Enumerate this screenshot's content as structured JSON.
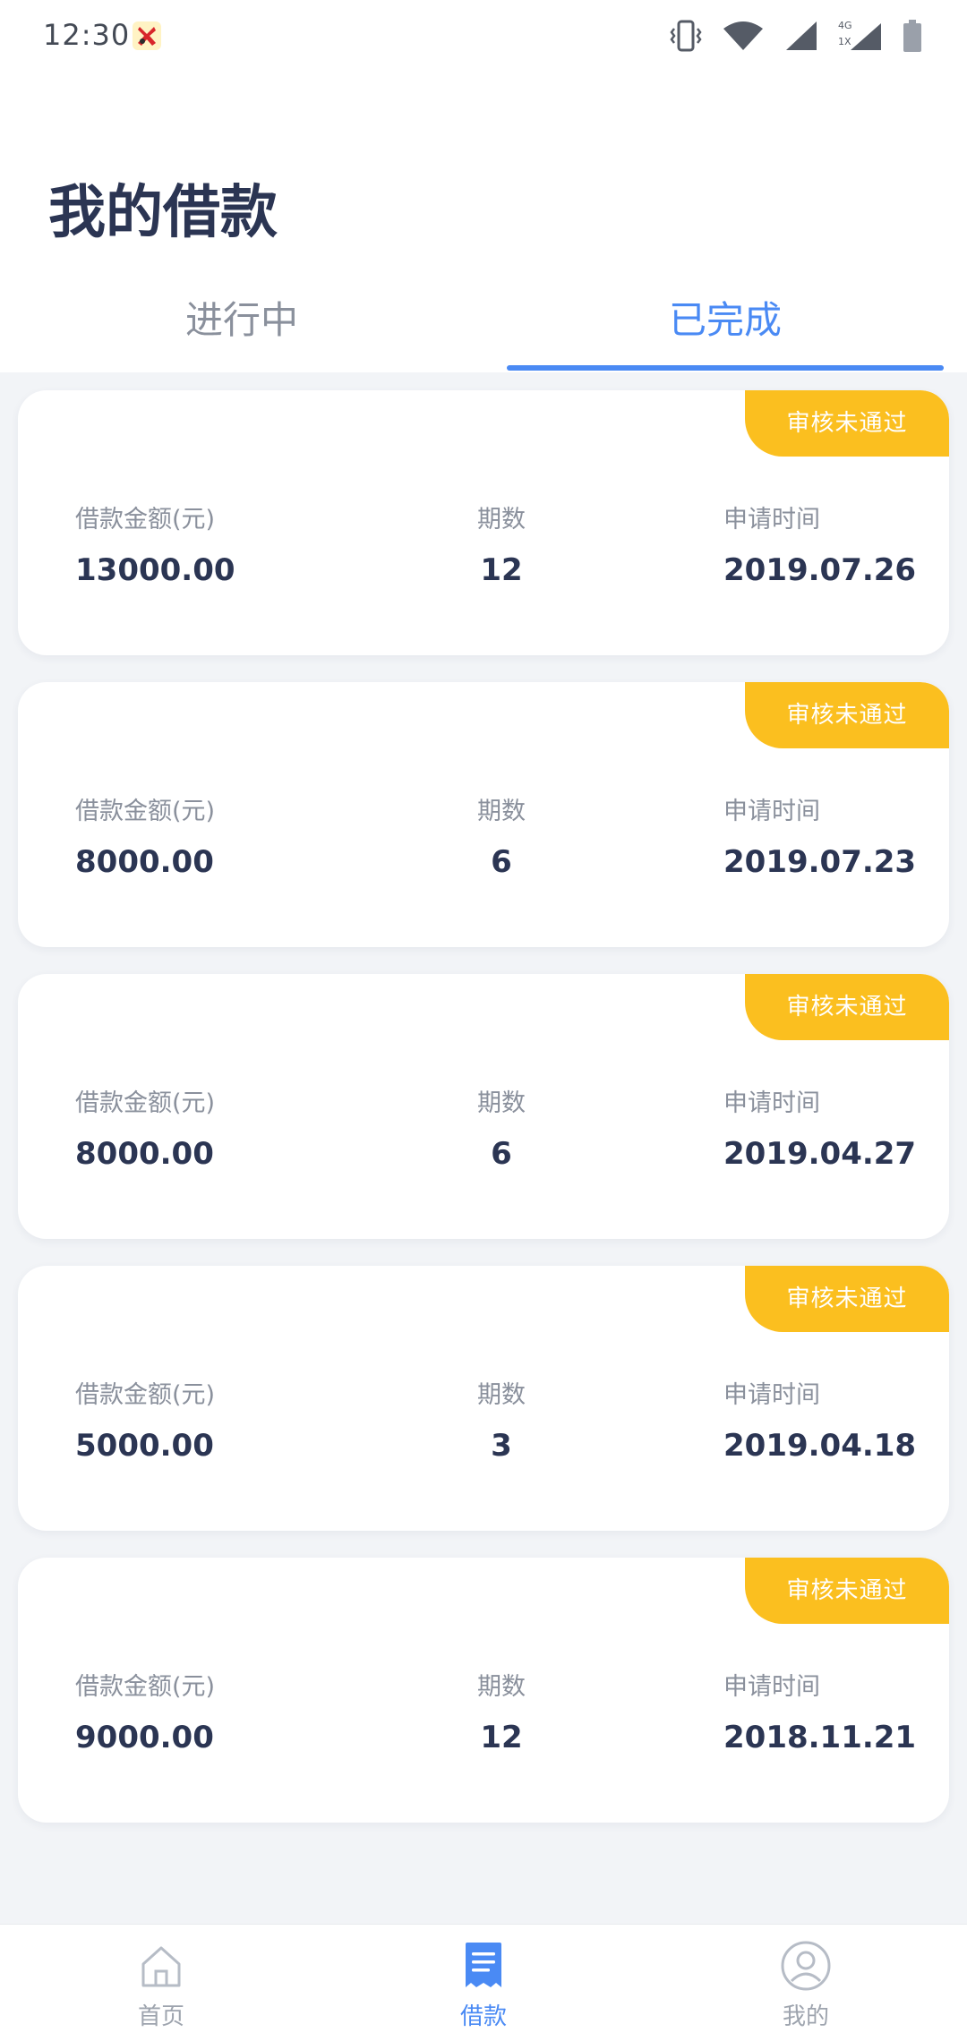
{
  "status_bar": {
    "time": "12:30",
    "network_label_top": "4G",
    "network_label_bottom": "1X",
    "icons": [
      "app-notification-icon",
      "vibrate-icon",
      "wifi-icon",
      "signal-icon",
      "signal-4g-icon",
      "battery-icon"
    ]
  },
  "page": {
    "title": "我的借款"
  },
  "tabs": [
    {
      "label": "进行中",
      "active": false
    },
    {
      "label": "已完成",
      "active": true
    }
  ],
  "colors": {
    "accent": "#4a8af4",
    "badge": "#fbbf1f",
    "title": "#2b3553",
    "muted": "#8a909c",
    "background": "#f2f4f7"
  },
  "labels": {
    "amount": "借款金额(元)",
    "periods": "期数",
    "date": "申请时间"
  },
  "loans": [
    {
      "status": "审核未通过",
      "amount": "13000.00",
      "periods": "12",
      "date": "2019.07.26"
    },
    {
      "status": "审核未通过",
      "amount": "8000.00",
      "periods": "6",
      "date": "2019.07.23"
    },
    {
      "status": "审核未通过",
      "amount": "8000.00",
      "periods": "6",
      "date": "2019.04.27"
    },
    {
      "status": "审核未通过",
      "amount": "5000.00",
      "periods": "3",
      "date": "2019.04.18"
    },
    {
      "status": "审核未通过",
      "amount": "9000.00",
      "periods": "12",
      "date": "2018.11.21"
    }
  ],
  "bottom_nav": [
    {
      "label": "首页",
      "icon": "home-icon",
      "active": false
    },
    {
      "label": "借款",
      "icon": "loan-document-icon",
      "active": true
    },
    {
      "label": "我的",
      "icon": "user-profile-icon",
      "active": false
    }
  ]
}
